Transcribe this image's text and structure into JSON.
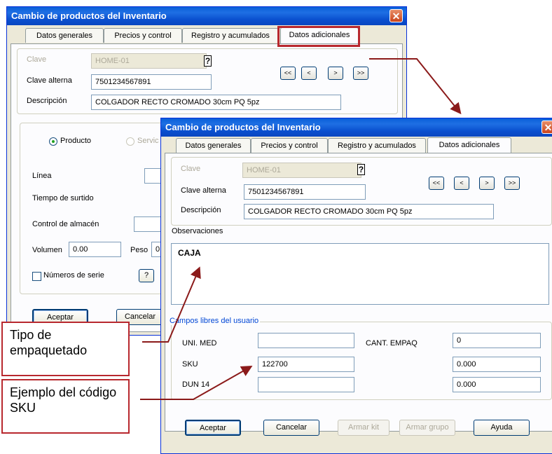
{
  "window1": {
    "title": "Cambio de productos del Inventario",
    "tabs": [
      "Datos generales",
      "Precios y control",
      "Registro y acumulados",
      "Datos adicionales"
    ],
    "clave_label": "Clave",
    "clave_value": "HOME-01",
    "clave_alterna_label": "Clave alterna",
    "clave_alterna_value": "7501234567891",
    "descripcion_label": "Descripción",
    "descripcion_value": "COLGADOR RECTO CROMADO 30cm PQ 5pz",
    "nav": [
      "<<",
      "<",
      ">",
      ">>"
    ],
    "producto": "Producto",
    "servicio": "Servic",
    "linea": "Línea",
    "tiempo": "Tiempo de surtido",
    "control": "Control de almacén",
    "volumen_label": "Volumen",
    "volumen_value": "0.00",
    "peso_label": "Peso",
    "peso_value": "0",
    "numeros_serie": "Números de serie",
    "help": "?",
    "aceptar": "Aceptar",
    "cancelar": "Cancelar"
  },
  "window2": {
    "title": "Cambio de productos del Inventario",
    "tabs": [
      "Datos generales",
      "Precios y control",
      "Registro y acumulados",
      "Datos adicionales"
    ],
    "clave_label": "Clave",
    "clave_value": "HOME-01",
    "clave_alterna_label": "Clave alterna",
    "clave_alterna_value": "7501234567891",
    "descripcion_label": "Descripción",
    "descripcion_value": "COLGADOR RECTO CROMADO 30cm PQ 5pz",
    "nav": [
      "<<",
      "<",
      ">",
      ">>"
    ],
    "observaciones_label": "Observaciones",
    "observaciones_value": "CAJA",
    "campos_label": "Campos libres del usuario",
    "uni_med": "UNI. MED",
    "sku": "SKU",
    "sku_value": "122700",
    "dun14": "DUN 14",
    "cant_empaq": "CANT. EMPAQ",
    "cant_empaq_value": "0",
    "field2_value": "0.000",
    "field3_value": "0.000",
    "buttons": [
      "Aceptar",
      "Cancelar",
      "Armar kit",
      "Armar grupo",
      "Ayuda"
    ]
  },
  "callouts": {
    "tipo": "Tipo de empaquetado",
    "ejemplo": "Ejemplo del código SKU"
  },
  "colors": {
    "callout_border": "#b8282e",
    "arrow": "#8b1a1a",
    "title_bar": "#0a5fd8"
  }
}
